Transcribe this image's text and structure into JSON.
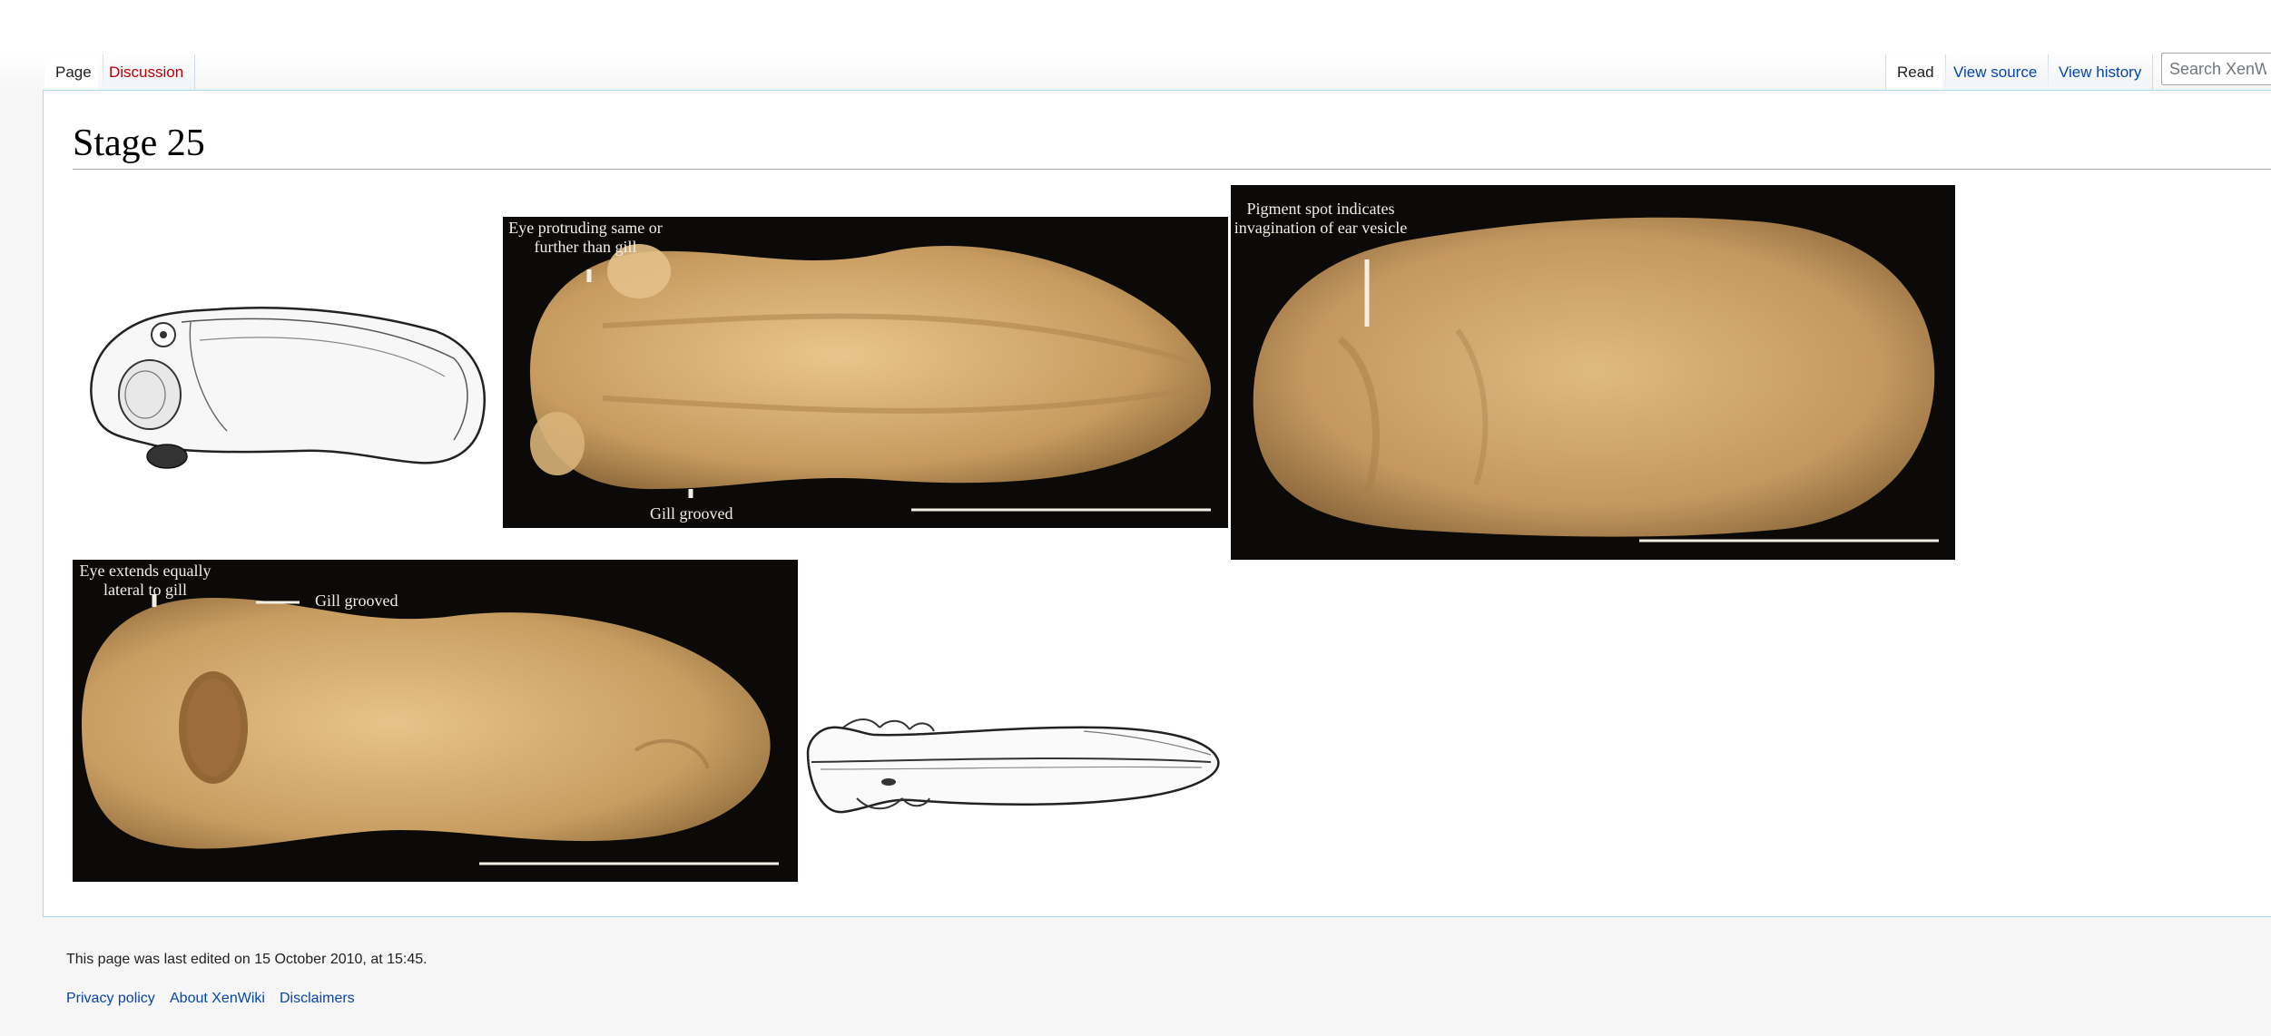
{
  "tabs": {
    "page": "Page",
    "discussion": "Discussion",
    "read": "Read",
    "view_source": "View source",
    "view_history": "View history"
  },
  "search": {
    "placeholder": "Search XenWiki"
  },
  "page_title": "Stage 25",
  "figures": {
    "top_middle": {
      "label_eye": "Eye protruding same or\nfurther than gill",
      "label_gill": "Gill grooved"
    },
    "top_right": {
      "label_pigment": "Pigment spot indicates\ninvagination of ear vesicle"
    },
    "bottom_left": {
      "label_eye": "Eye extends equally\nlateral to gill",
      "label_gill": "Gill grooved"
    }
  },
  "footer": {
    "last_edited": "This page was last edited on 15 October 2010, at 15:45.",
    "links": [
      "Privacy policy",
      "About XenWiki",
      "Disclaimers"
    ]
  },
  "colors": {
    "link": "#0645ad",
    "new_link": "#ba0000",
    "photo_background": "#0b0a08",
    "embryo_tan": "#d9b37a"
  }
}
